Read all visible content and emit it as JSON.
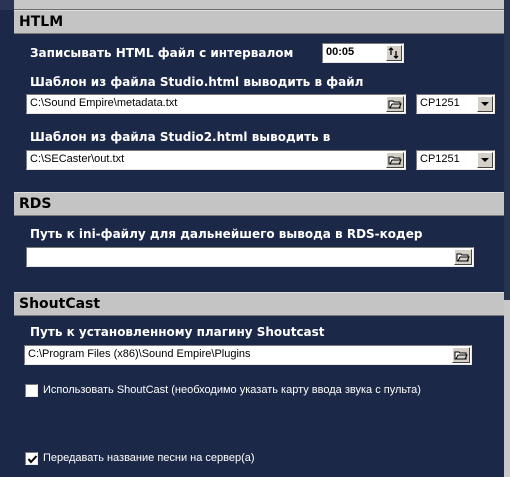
{
  "sections": {
    "htlm": {
      "title": "HTLM",
      "interval_label": "Записывать HTML файл с интервалом",
      "interval_value": "00:05",
      "template1_label": "Шаблон из файла Studio.html выводить в файл",
      "template1_path": "C:\\Sound Empire\\metadata.txt",
      "template1_encoding": "CP1251",
      "template2_label": "Шаблон из файла Studio2.html выводить в",
      "template2_path": "C:\\SECaster\\out.txt",
      "template2_encoding": "CP1251"
    },
    "rds": {
      "title": "RDS",
      "path_label": "Путь к ini-файлу для дальнейшего вывода в RDS-кодер",
      "path_value": ""
    },
    "shoutcast": {
      "title": "ShoutCast",
      "plugin_label": "Путь к установленному плагину Shoutcast",
      "plugin_path": "C:\\Program Files (x86)\\Sound Empire\\Plugins",
      "use_shoutcast_label": "Использовать ShoutCast (необходимо указать карту ввода звука с пульта)",
      "use_shoutcast_checked": false,
      "send_song_title_label": "Передавать название песни на сервер(а)",
      "send_song_title_checked": true
    }
  },
  "icons": {
    "browse": "folder-open-icon",
    "dropdown": "chevron-down-icon",
    "spinner": "spin-arrows-icon",
    "check": "checkmark-icon"
  },
  "colors": {
    "panel_bg": "#1c2847",
    "header_bg": "#c4c4c4",
    "label_text": "#ffffff"
  }
}
